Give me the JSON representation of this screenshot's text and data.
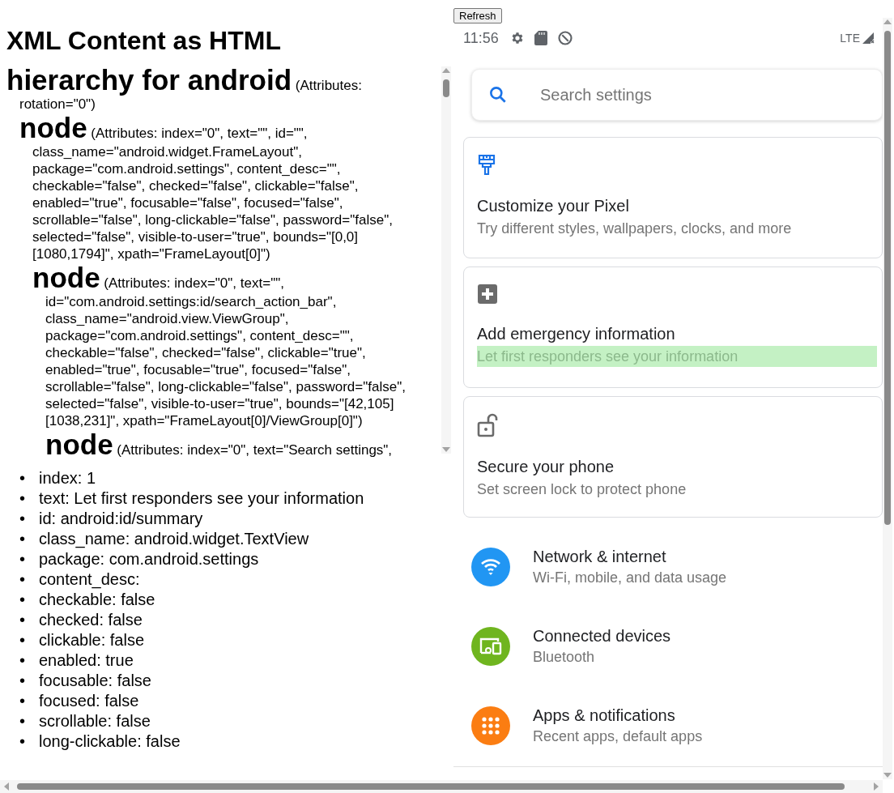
{
  "title": "XML Content as HTML",
  "tree": {
    "tag": "hierarchy for android",
    "attributes": "(Attributes: rotation=\"0\")",
    "children": [
      {
        "tag": "node",
        "attributes": "(Attributes: index=\"0\", text=\"\", id=\"\", class_name=\"android.widget.FrameLayout\", package=\"com.android.settings\", content_desc=\"\", checkable=\"false\", checked=\"false\", clickable=\"false\", enabled=\"true\", focusable=\"false\", focused=\"false\", scrollable=\"false\", long-clickable=\"false\", password=\"false\", selected=\"false\", visible-to-user=\"true\", bounds=\"[0,0][1080,1794]\", xpath=\"FrameLayout[0]\")",
        "children": [
          {
            "tag": "node",
            "attributes": "(Attributes: index=\"0\", text=\"\", id=\"com.android.settings:id/search_action_bar\", class_name=\"android.view.ViewGroup\", package=\"com.android.settings\", content_desc=\"\", checkable=\"false\", checked=\"false\", clickable=\"true\", enabled=\"true\", focusable=\"true\", focused=\"false\", scrollable=\"false\", long-clickable=\"false\", password=\"false\", selected=\"false\", visible-to-user=\"true\", bounds=\"[42,105][1038,231]\", xpath=\"FrameLayout[0]/ViewGroup[0]\")",
            "children": [
              {
                "tag": "node",
                "attributes": "(Attributes: index=\"0\", text=\"Search settings\","
              }
            ]
          }
        ]
      }
    ]
  },
  "selected_attributes": [
    {
      "marker": "•",
      "text": "index: 1"
    },
    {
      "marker": "•",
      "text": "text: Let first responders see your information"
    },
    {
      "marker": "•",
      "text": "id: android:id/summary"
    },
    {
      "marker": "•",
      "text": "class_name: android.widget.TextView"
    },
    {
      "marker": "•",
      "text": "package: com.android.settings"
    },
    {
      "marker": "•",
      "text": "content_desc:"
    },
    {
      "marker": "•",
      "text": "checkable: false"
    },
    {
      "marker": "•",
      "text": "checked: false"
    },
    {
      "marker": "•",
      "text": "clickable: false"
    },
    {
      "marker": "•",
      "text": "enabled: true"
    },
    {
      "marker": "•",
      "text": "focusable: false"
    },
    {
      "marker": "•",
      "text": "focused: false"
    },
    {
      "marker": "•",
      "text": "scrollable: false"
    },
    {
      "marker": "•",
      "text": "long-clickable: false"
    }
  ],
  "refresh_button": "Refresh",
  "status_bar": {
    "time": "11:56",
    "network": "LTE"
  },
  "search": {
    "placeholder": "Search settings"
  },
  "suggestions": [
    {
      "title": "Customize your Pixel",
      "summary": "Try different styles, wallpapers, clocks, and more",
      "highlighted": false
    },
    {
      "title": "Add emergency information",
      "summary": "Let first responders see your information",
      "highlighted": true
    },
    {
      "title": "Secure your phone",
      "summary": "Set screen lock to protect phone",
      "highlighted": false
    }
  ],
  "settings": [
    {
      "color": "#2196f3",
      "title": "Network & internet",
      "summary": "Wi-Fi, mobile, and data usage"
    },
    {
      "color": "#6fb51f",
      "title": "Connected devices",
      "summary": "Bluetooth"
    },
    {
      "color": "#fb7d12",
      "title": "Apps & notifications",
      "summary": "Recent apps, default apps"
    }
  ]
}
